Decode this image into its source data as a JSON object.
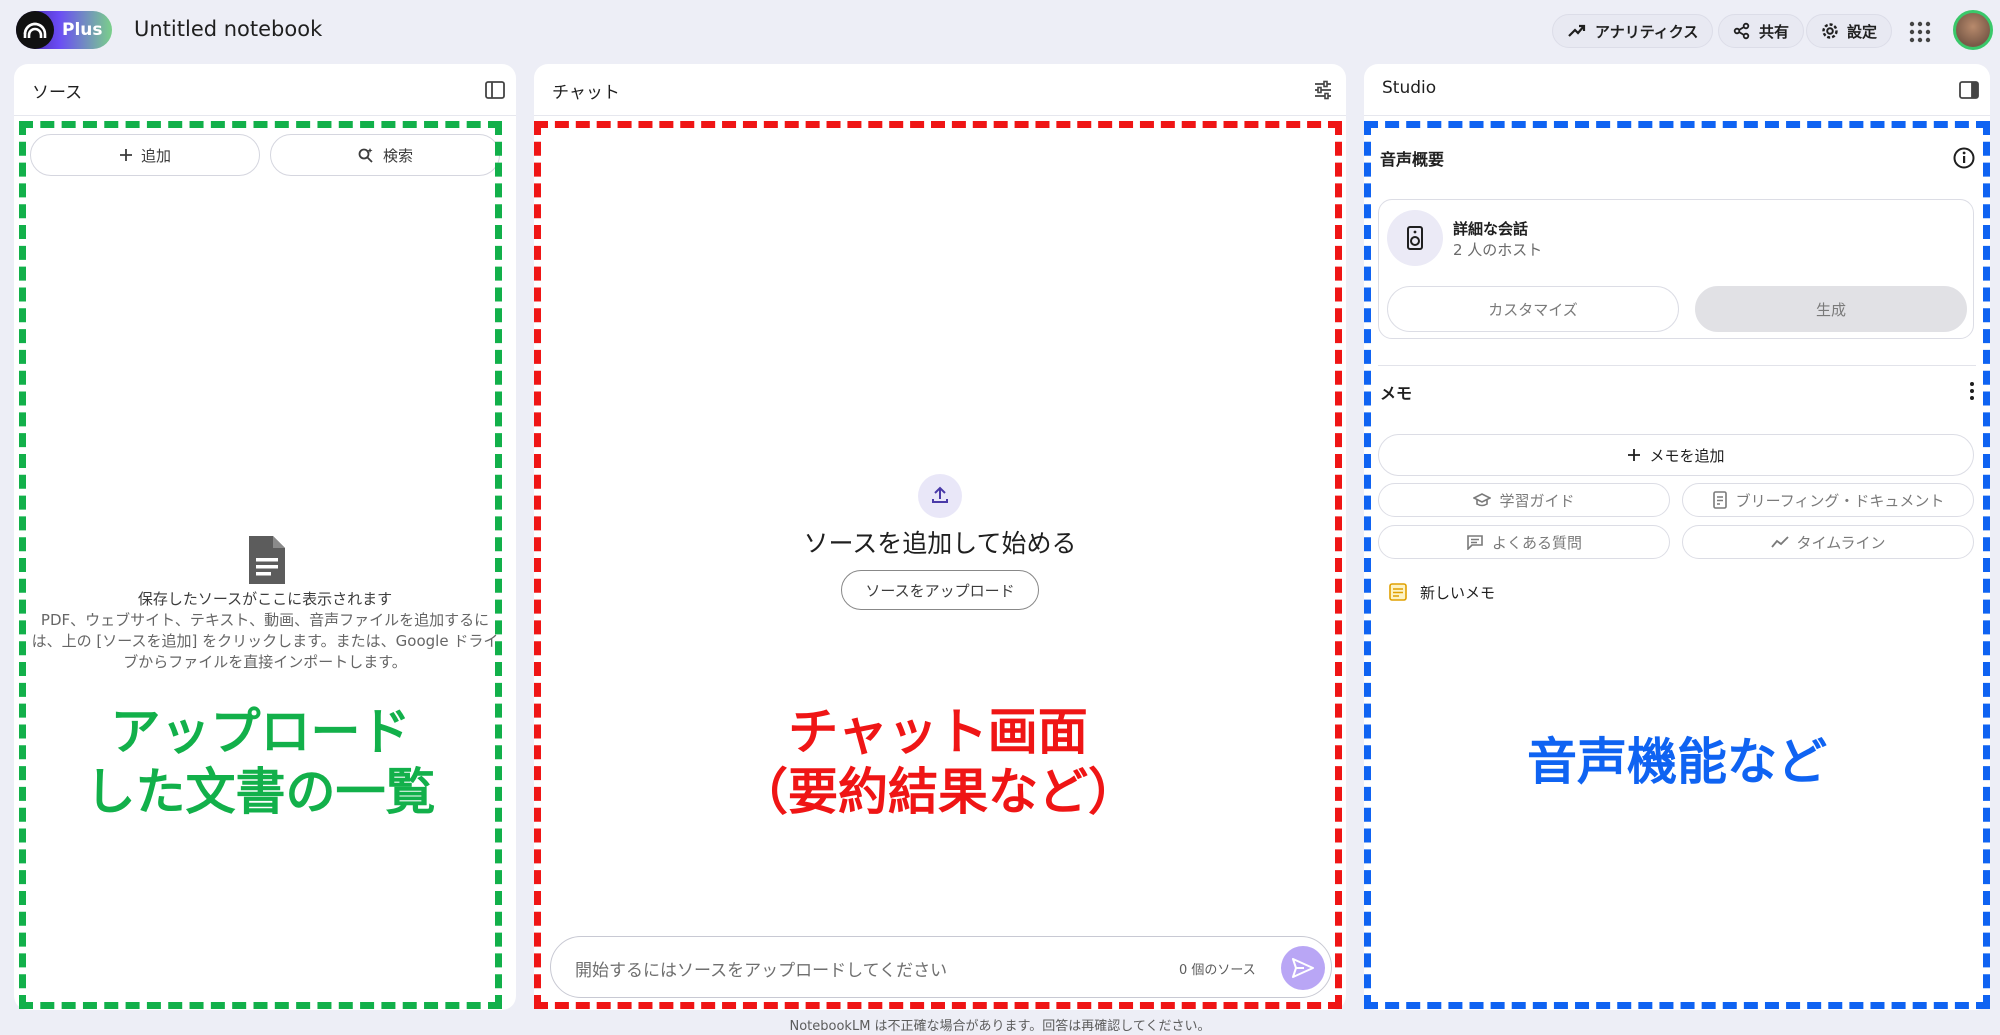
{
  "header": {
    "logo_badge": "Plus",
    "notebook_title": "Untitled notebook",
    "analytics_label": "アナリティクス",
    "share_label": "共有",
    "settings_label": "設定"
  },
  "sources": {
    "title": "ソース",
    "add_label": "追加",
    "search_label": "検索",
    "empty_title": "保存したソースがここに表示されます",
    "empty_line1": "PDF、ウェブサイト、テキスト、動画、音声ファイルを追加するに",
    "empty_line2": "は、上の [ソースを追加] をクリックします。または、Google ドライ",
    "empty_line3": "ブからファイルを直接インポートします。"
  },
  "chat": {
    "title": "チャット",
    "start_heading": "ソースを追加して始める",
    "upload_label": "ソースをアップロード",
    "input_placeholder": "開始するにはソースをアップロードしてください",
    "source_count": "0 個のソース"
  },
  "studio": {
    "title": "Studio",
    "audio_title": "音声概要",
    "audio_card_title": "詳細な会話",
    "audio_card_subtitle": "2 人のホスト",
    "customize_label": "カスタマイズ",
    "generate_label": "生成",
    "memo_title": "メモ",
    "add_memo_label": "メモを追加",
    "study_guide_label": "学習ガイド",
    "briefing_label": "ブリーフィング・ドキュメント",
    "faq_label": "よくある質問",
    "timeline_label": "タイムライン",
    "new_memo_label": "新しいメモ"
  },
  "annotations": {
    "left_line1": "アップロード",
    "left_line2": "した文書の一覧",
    "center_line1": "チャット画面",
    "center_line2": "（要約結果など）",
    "right_line1": "音声機能など",
    "left_color": "#12b04a",
    "center_color": "#ef1515",
    "right_color": "#0f63f2"
  },
  "footer": {
    "disclaimer": "NotebookLM は不正確な場合があります。回答は再確認してください。"
  }
}
